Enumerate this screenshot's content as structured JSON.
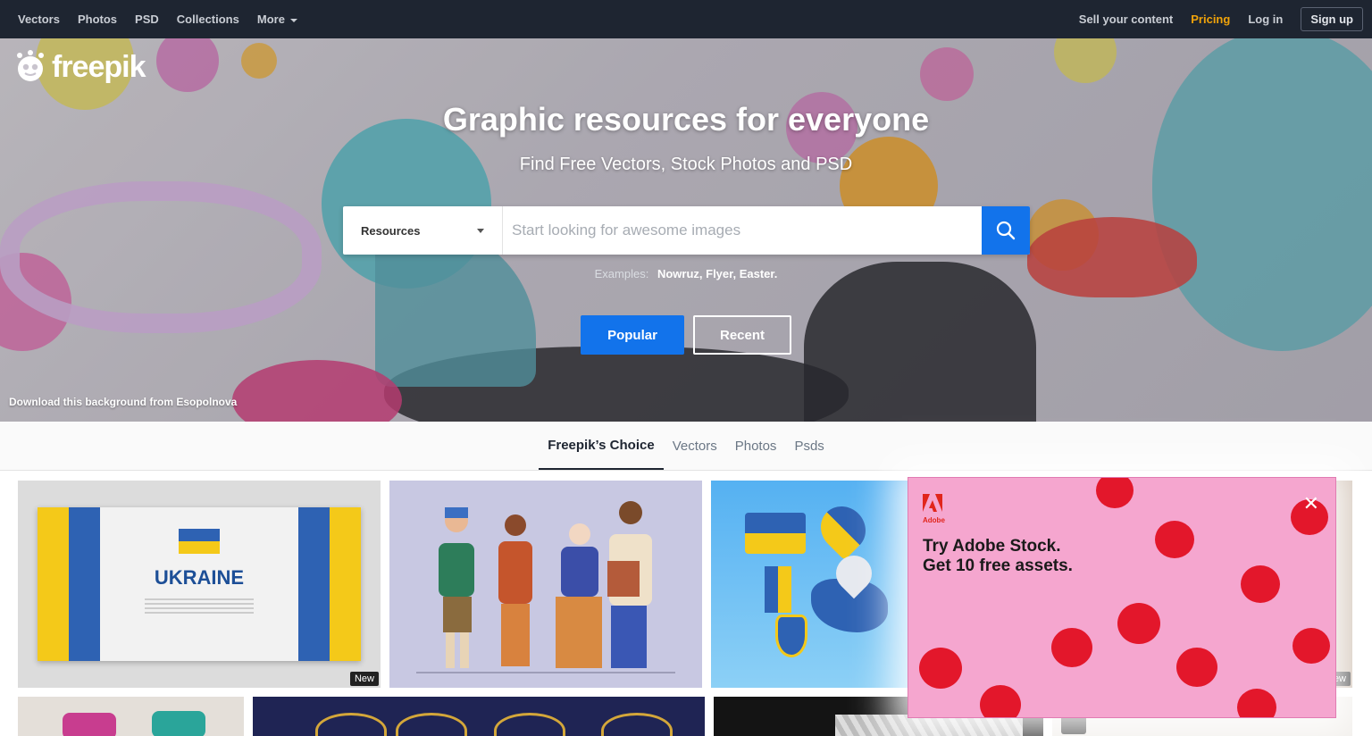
{
  "topnav": {
    "left": [
      "Vectors",
      "Photos",
      "PSD",
      "Collections"
    ],
    "more": "More",
    "sell": "Sell your content",
    "pricing": "Pricing",
    "login": "Log in",
    "signup": "Sign up"
  },
  "logo": {
    "text": "freepik"
  },
  "hero": {
    "title": "Graphic resources for everyone",
    "subtitle": "Find Free Vectors, Stock Photos and PSD",
    "search": {
      "select_value": "Resources",
      "placeholder": "Start looking for awesome images"
    },
    "examples_label": "Examples:",
    "examples": [
      "Nowruz,",
      "Flyer,",
      "Easter."
    ],
    "popular": "Popular",
    "recent": "Recent",
    "bg_credit": "Download this background from Esopolnova"
  },
  "tabs": [
    "Freepik’s Choice",
    "Vectors",
    "Photos",
    "Psds"
  ],
  "tiles": {
    "ukraine_text": "UKRAINE",
    "badge_new": "New",
    "badge_partial": "ew"
  },
  "ad": {
    "brand": "Adobe",
    "line1": "Try Adobe Stock.",
    "line2": "Get 10 free assets.",
    "close": "✕"
  },
  "colors": {
    "nav_bg": "#1e2531",
    "accent_blue": "#1273eb",
    "pricing": "#f0a30a",
    "ad_bg": "#f5a6cf",
    "adobe_red": "#e1251b"
  }
}
